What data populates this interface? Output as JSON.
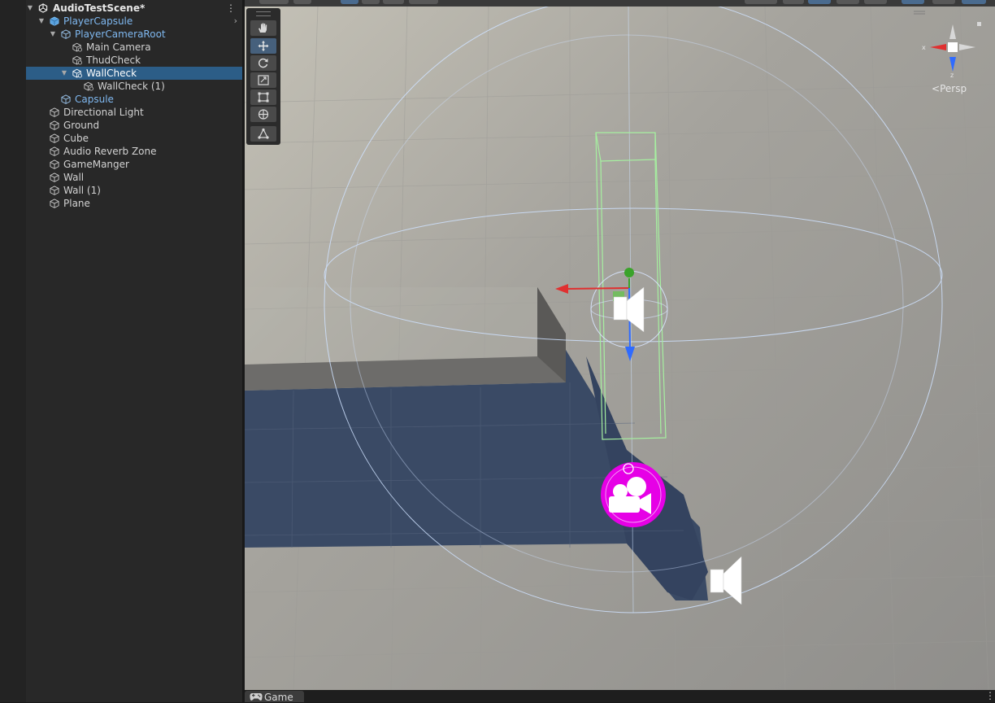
{
  "hierarchy": {
    "scene_name": "AudioTestScene*",
    "items": [
      {
        "label": "PlayerCapsule"
      },
      {
        "label": "PlayerCameraRoot"
      },
      {
        "label": "Main Camera"
      },
      {
        "label": "ThudCheck"
      },
      {
        "label": "WallCheck"
      },
      {
        "label": "WallCheck (1)"
      },
      {
        "label": "Capsule"
      },
      {
        "label": "Directional Light"
      },
      {
        "label": "Ground"
      },
      {
        "label": "Cube"
      },
      {
        "label": "Audio Reverb Zone"
      },
      {
        "label": "GameManger"
      },
      {
        "label": "Wall"
      },
      {
        "label": "Wall (1)"
      },
      {
        "label": "Plane"
      }
    ],
    "selected": "WallCheck"
  },
  "scene_view": {
    "projection_label": "Persp",
    "gizmo_axes": {
      "x": "x",
      "z": "z"
    },
    "tools": [
      "hand-tool",
      "move-tool",
      "rotate-tool",
      "scale-tool",
      "rect-tool",
      "transform-tool",
      "custom-tool"
    ],
    "active_tool": "move-tool"
  },
  "bottom_tabs": [
    {
      "label": "Game",
      "icon": "gamepad-icon"
    }
  ],
  "colors": {
    "selection": "#2c5d87",
    "prefab_text": "#7fb8f0",
    "camera_gizmo": "#e600e6",
    "axis_x": "#e03030",
    "axis_y": "#3aa32a",
    "axis_z": "#2f6bff"
  }
}
